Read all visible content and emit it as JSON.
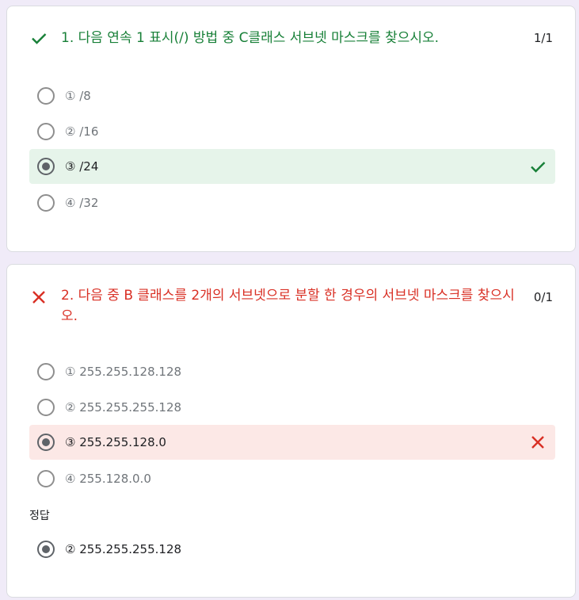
{
  "questions": [
    {
      "title": "1. 다음 연속 1 표시(/) 방법 중 C클래스 서브넷 마스크를 찾으시오.",
      "score": "1/1",
      "status": "correct",
      "status_icon": "check-icon",
      "options": [
        {
          "label": "① /8",
          "selected": false
        },
        {
          "label": "② /16",
          "selected": false
        },
        {
          "label": "③ /24",
          "selected": true,
          "result_icon": "check-icon"
        },
        {
          "label": "④ /32",
          "selected": false
        }
      ]
    },
    {
      "title": "2. 다음 중 B 클래스를 2개의 서브넷으로 분할 한 경우의 서브넷 마스크를 찾으시오.",
      "score": "0/1",
      "status": "incorrect",
      "status_icon": "close-icon",
      "options": [
        {
          "label": "① 255.255.128.128",
          "selected": false
        },
        {
          "label": "② 255.255.255.128",
          "selected": false
        },
        {
          "label": "③ 255.255.128.0",
          "selected": true,
          "result_icon": "close-icon"
        },
        {
          "label": "④ 255.128.0.0",
          "selected": false
        }
      ],
      "correct_answer_heading": "정답",
      "correct_answer": "② 255.255.255.128"
    }
  ],
  "colors": {
    "page_background": "#f0ebf8",
    "correct": "#188038",
    "correct_bg": "#e6f4ea",
    "incorrect": "#d93025",
    "incorrect_bg": "#fce8e6"
  }
}
